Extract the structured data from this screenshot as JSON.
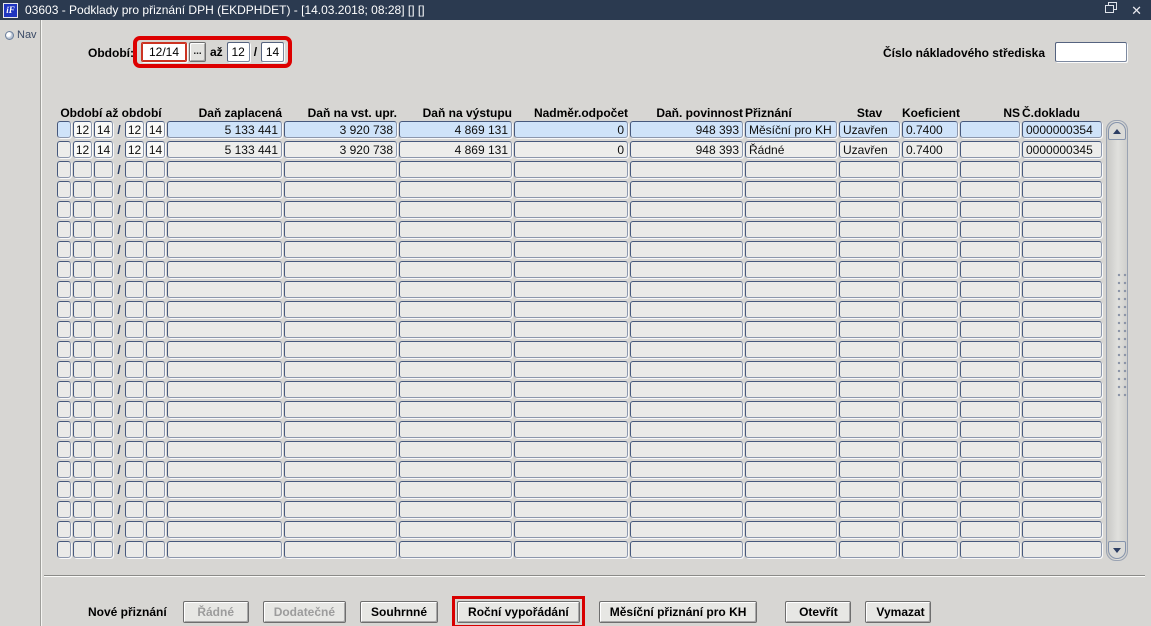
{
  "window": {
    "title": "03603 - Podklady pro přiznání DPH (EKDPHDET) - [14.03.2018; 08:28] [] []",
    "icon_text": "iF",
    "close_glyph": "✕"
  },
  "sidebar": {
    "nav_label": "Nav"
  },
  "filter": {
    "obdobi_label": "Období:",
    "obdobi_from": "12/14",
    "lov_button_label": "...",
    "az_label": "až",
    "to_month": "12",
    "slash": "/",
    "to_year": "14",
    "cost_center_label": "Číslo nákladového střediska",
    "cost_center_value": ""
  },
  "table": {
    "headers": [
      "Období až období",
      "Daň zaplacená",
      "Daň na vst. upr.",
      "Daň na výstupu",
      "Nadměr.odpočet",
      "Daň. povinnost",
      "Přiznání",
      "Stav",
      "Koeficient",
      "NS",
      "Č.dokladu"
    ],
    "slash": "/",
    "rows": [
      {
        "selected": true,
        "p1": "12",
        "p2": "14",
        "p3": "12",
        "p4": "14",
        "dan_zaplacena": "5 133 441",
        "dan_na_vst_upr": "3 920 738",
        "dan_na_vystupu": "4 869 131",
        "nadmer_odpocet": "0",
        "dan_povinnost": "948 393",
        "priznani": "Měsíční pro KH",
        "stav": "Uzavřen",
        "koeficient": "0.7400",
        "ns": "",
        "c_dokladu": "0000000354"
      },
      {
        "selected": false,
        "p1": "12",
        "p2": "14",
        "p3": "12",
        "p4": "14",
        "dan_zaplacena": "5 133 441",
        "dan_na_vst_upr": "3 920 738",
        "dan_na_vystupu": "4 869 131",
        "nadmer_odpocet": "0",
        "dan_povinnost": "948 393",
        "priznani": "Řádné",
        "stav": "Uzavřen",
        "koeficient": "0.7400",
        "ns": "",
        "c_dokladu": "0000000345"
      }
    ],
    "empty_row_count": 20
  },
  "footer": {
    "group_label": "Nové přiznání",
    "buttons": [
      {
        "label": "Řádné",
        "disabled": true,
        "highlighted": false
      },
      {
        "label": "Dodatečné",
        "disabled": true,
        "highlighted": false
      },
      {
        "label": "Souhrnné",
        "disabled": false,
        "highlighted": false
      },
      {
        "label": "Roční vypořádání",
        "disabled": false,
        "highlighted": true
      },
      {
        "label": "Měsíční přiznání pro KH",
        "disabled": false,
        "highlighted": false
      }
    ],
    "open_button": "Otevřít",
    "clear_button": "Vymazat"
  },
  "colors": {
    "titlebar": "#2b3a50",
    "selected_row": "#cfe3f9",
    "annotation": "#dd0000"
  }
}
